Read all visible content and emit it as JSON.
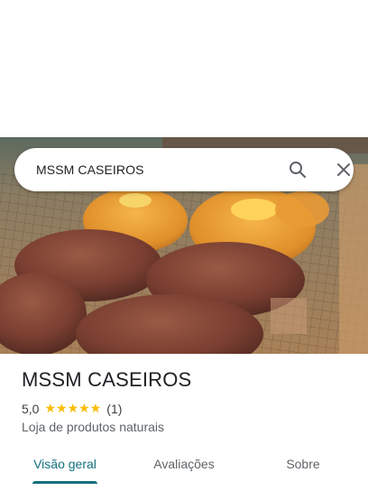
{
  "search": {
    "query": "MSSM CASEIROS",
    "search_icon": "search-icon",
    "close_icon": "close-icon"
  },
  "hero": {
    "image": "photo of baked muffins and bundt cakes on a cooling rack"
  },
  "place": {
    "name": "MSSM CASEIROS",
    "rating": "5,0",
    "stars": 5,
    "review_count": "(1)",
    "category": "Loja de produtos naturais"
  },
  "tabs": [
    {
      "label": "Visão geral",
      "active": true
    },
    {
      "label": "Avaliações",
      "active": false
    },
    {
      "label": "Sobre",
      "active": false
    }
  ],
  "colors": {
    "accent": "#12707e",
    "star": "#fbbc04",
    "text_primary": "#202124",
    "text_secondary": "#5f6368"
  }
}
